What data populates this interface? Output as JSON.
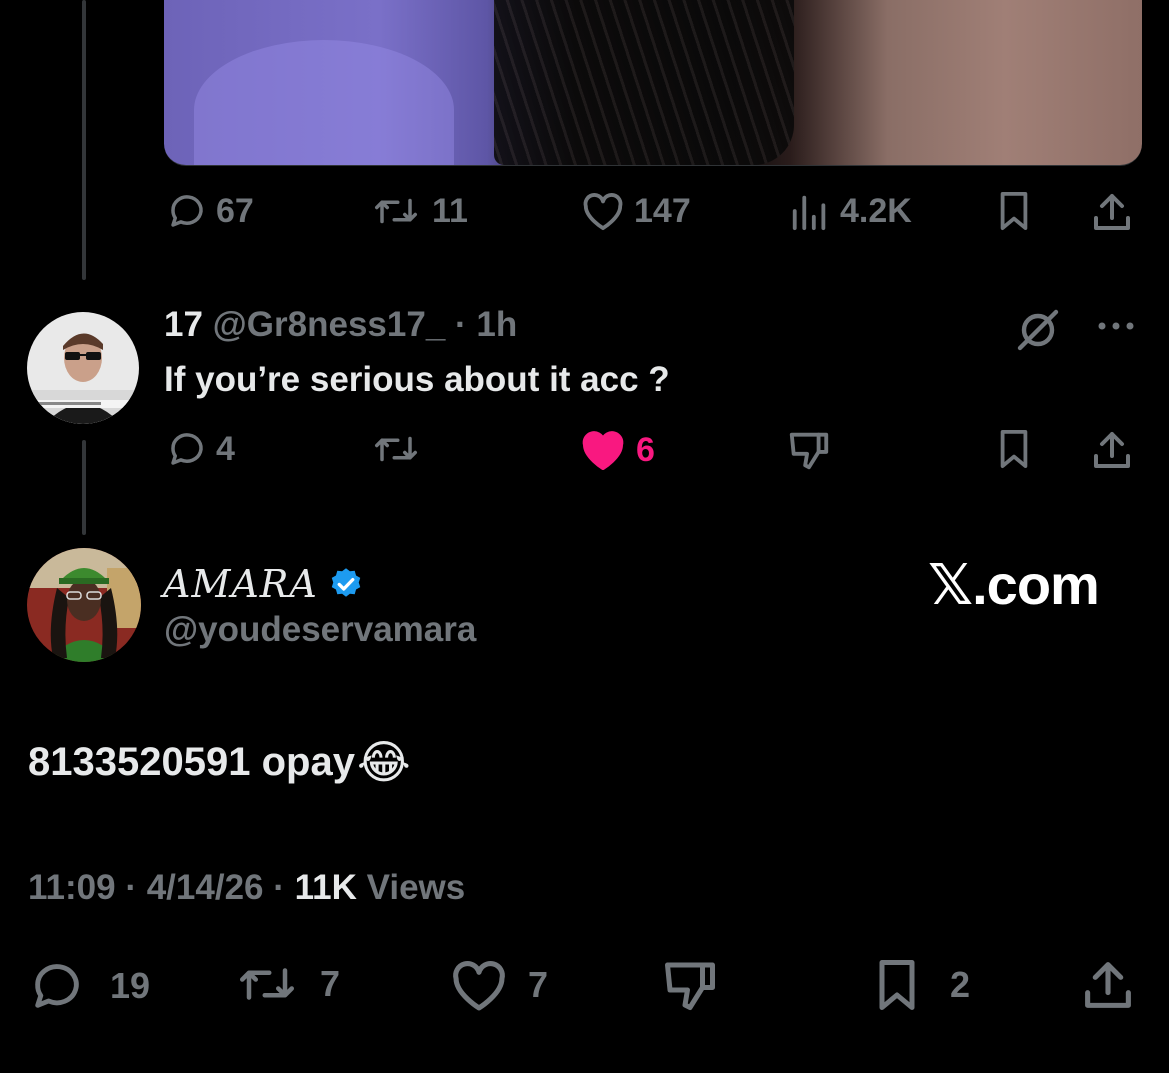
{
  "colors": {
    "background": "#000000",
    "muted": "#71767b",
    "text": "#e7e9ea",
    "like": "#f91880",
    "verified": "#1d9bf0"
  },
  "top_post": {
    "stats": {
      "replies": "67",
      "reposts": "11",
      "likes": "147",
      "views": "4.2K"
    }
  },
  "reply": {
    "display_name": "17",
    "handle": "@Gr8ness17_",
    "separator": "·",
    "time": "1h",
    "text": "If you’re serious about it acc ?",
    "stats": {
      "replies": "4",
      "likes": "6"
    },
    "liked": true
  },
  "main_post": {
    "display_name": "AMARA",
    "verified": true,
    "handle": "@youdeservamara",
    "watermark": "𝕏.com",
    "text": "8133520591 opay",
    "emoji": "😂",
    "time": "11:09",
    "date": "4/14/26",
    "separator": "·",
    "views_count": "11K",
    "views_label": "Views",
    "stats": {
      "replies": "19",
      "reposts": "7",
      "likes": "7",
      "bookmarks": "2"
    }
  },
  "icons": [
    "reply-icon",
    "repost-icon",
    "like-icon",
    "views-icon",
    "bookmark-icon",
    "share-icon",
    "grok-icon",
    "more-icon",
    "dislike-icon",
    "verified-badge-icon"
  ]
}
